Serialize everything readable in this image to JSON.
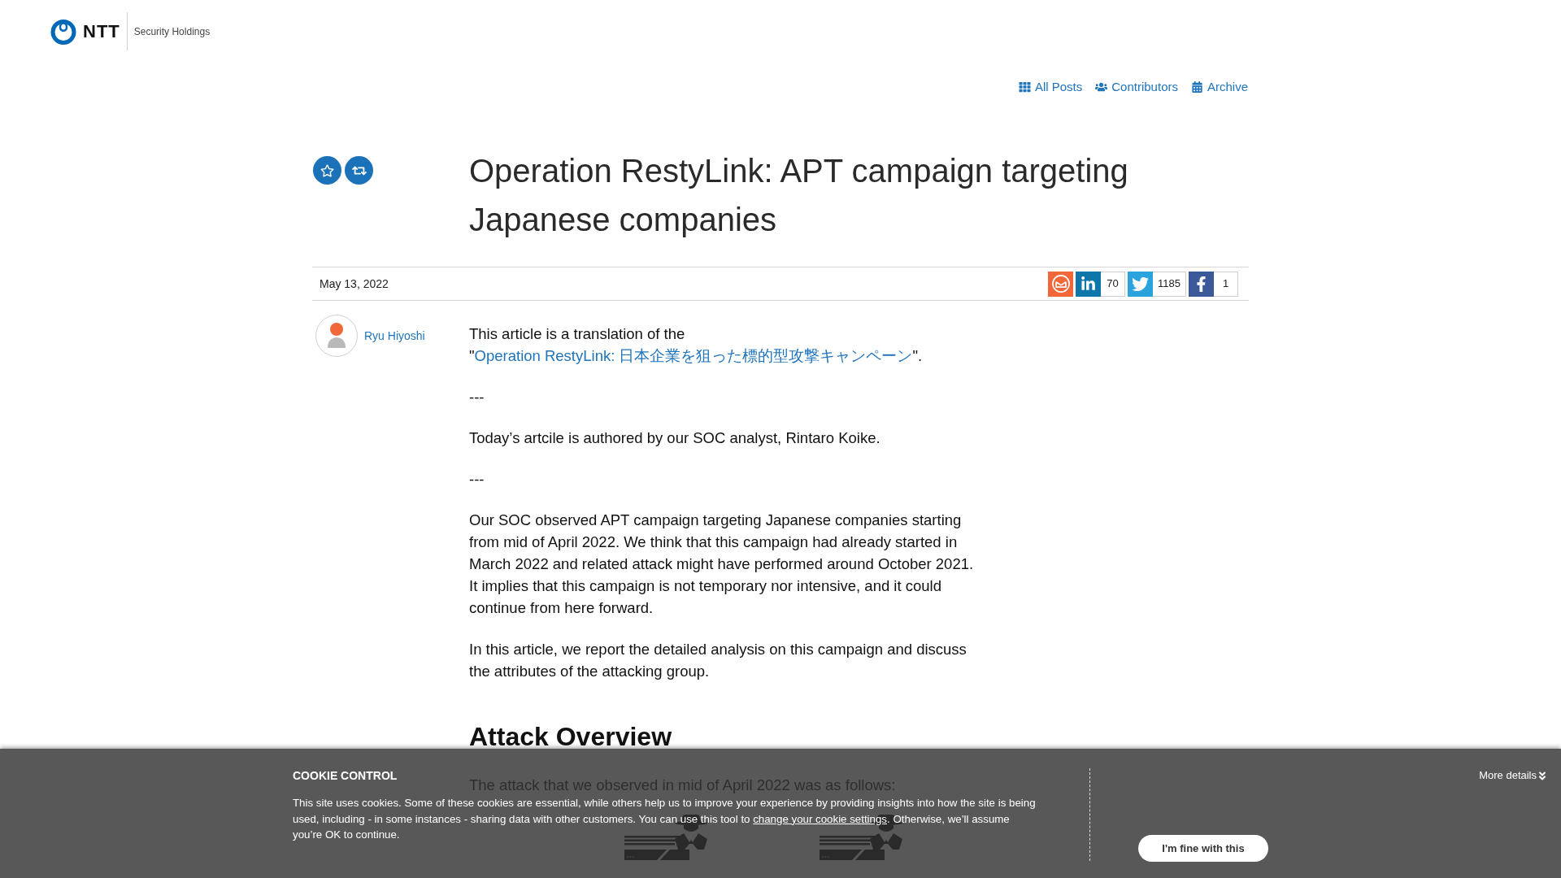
{
  "header": {
    "logo_wordmark": "NTT",
    "logo_subtitle": "Security Holdings",
    "nav": [
      {
        "label": "All Posts"
      },
      {
        "label": "Contributors"
      },
      {
        "label": "Archive"
      }
    ]
  },
  "article": {
    "title": "Operation RestyLink: APT campaign targeting Japanese companies",
    "date": "May 13, 2022",
    "share": [
      {
        "kind": "email"
      },
      {
        "kind": "linkedin",
        "count": "70"
      },
      {
        "kind": "twitter",
        "count": "1185"
      },
      {
        "kind": "facebook",
        "count": "1"
      }
    ],
    "author": "Ryu Hiyoshi",
    "body": [
      {
        "kind": "paragraph",
        "text": "This article is a translation of the \"",
        "link": "Operation RestyLink: 日本企業を狙った標的型攻撃キャンペーン",
        "text_after": "\"."
      },
      {
        "kind": "paragraph",
        "text": "---"
      },
      {
        "kind": "paragraph",
        "text": "Today’s artcile is authored by our SOC analyst, Rintaro Koike."
      },
      {
        "kind": "paragraph",
        "text": "---"
      },
      {
        "kind": "paragraph",
        "text": "Our SOC observed APT campaign targeting Japanese companies starting from mid of April 2022. We think that this campaign had already started in March 2022 and related attack might have performed around October 2021. It implies that this campaign is not temporary nor intensive, and it could continue from here forward."
      },
      {
        "kind": "paragraph",
        "text": "In this article, we report the detailed analysis on this campaign and discuss the attributes of the attacking group."
      },
      {
        "kind": "heading",
        "text": "Attack Overview"
      },
      {
        "kind": "paragraph",
        "text": "The attack that we observed in mid of April 2022 was as follows:"
      },
      {
        "kind": "figure"
      }
    ]
  },
  "cookie_banner": {
    "title": "COOKIE CONTROL",
    "text": "This site uses cookies. Some of these cookies are essential, while others help us to improve your experience by providing insights into how the site is being used, including - in some instances - sharing data with other customers. You can use this tool to ",
    "link": "change your cookie settings",
    "text_after": ". Otherwise, we’ll assume you’re OK to continue.",
    "more_details": "More details",
    "button": "I'm fine with this"
  }
}
